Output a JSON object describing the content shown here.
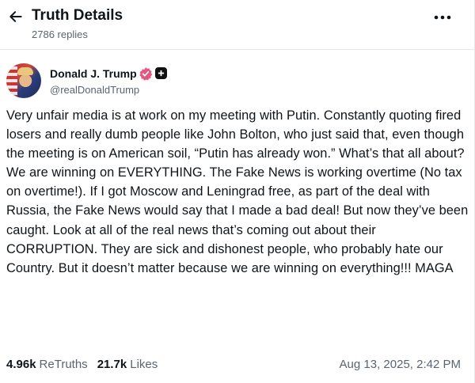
{
  "header": {
    "title": "Truth Details",
    "replies": "2786 replies"
  },
  "author": {
    "name": "Donald J. Trump",
    "handle": "@realDonaldTrump"
  },
  "post": {
    "text": "Very unfair media is at work on my meeting with Putin. Constantly quoting fired losers and really dumb people like John Bolton, who just said that, even though the meeting is on American soil, “Putin has already won.” What’s that all about? We are winning on EVERYTHING. The Fake News is working overtime (No tax on overtime!). If I got Moscow and Leningrad free, as part of the deal with Russia, the Fake News would say that I made a bad deal! But now they’ve been caught. Look at all of the real news that’s coming out about their CORRUPTION. They are sick and dishonest people, who probably hate our Country. But it doesn’t matter because we are winning on everything!!! MAGA"
  },
  "stats": {
    "retruths_count": "4.96k",
    "retruths_label": "ReTruths",
    "likes_count": "21.7k",
    "likes_label": "Likes",
    "timestamp": "Aug 13, 2025, 2:42 PM"
  },
  "icons": {
    "back": "arrow-left-icon",
    "more": "more-horizontal-icon",
    "verified": "verified-badge-icon",
    "plus": "plus-badge-icon"
  },
  "colors": {
    "text": "#0f1419",
    "muted": "#5a6470",
    "verified": "#e05a84",
    "divider": "#e6e8eb"
  }
}
